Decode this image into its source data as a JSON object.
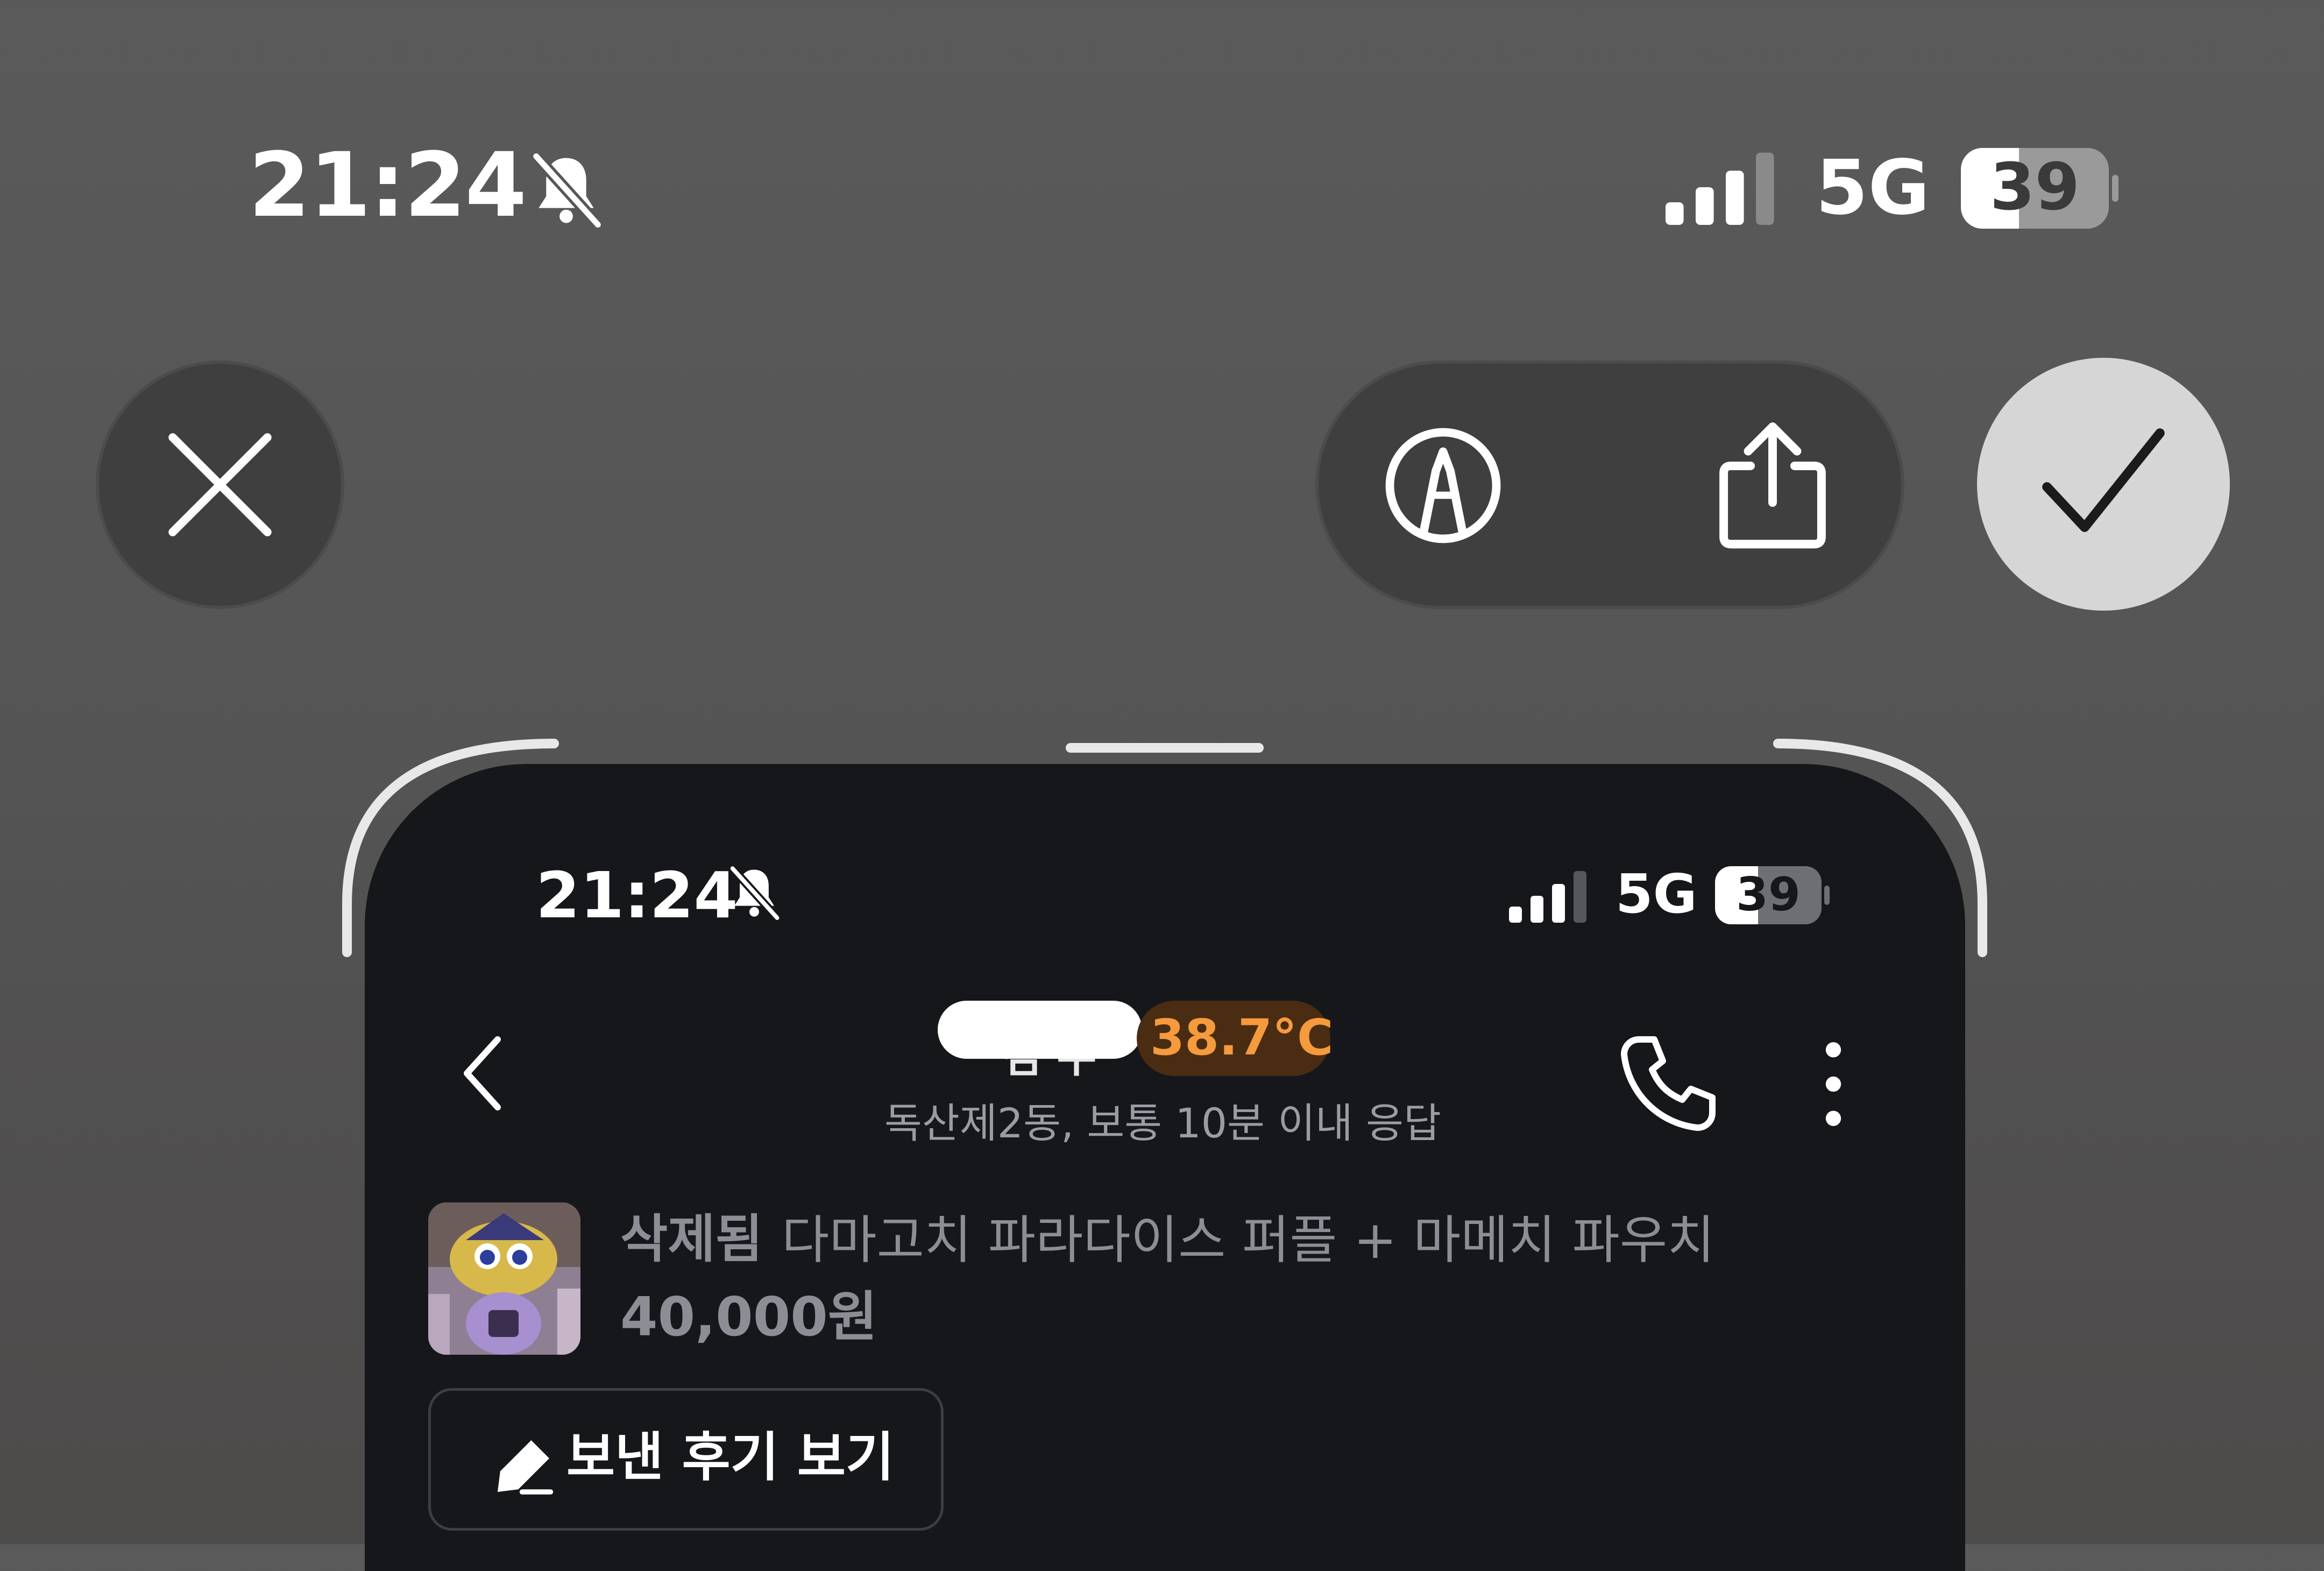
{
  "status_bar": {
    "time": "21:24",
    "network": "5G",
    "battery": "39",
    "battery_level": 0.39,
    "signal_bars_active": 3,
    "signal_bars_total": 4,
    "silent_mode_icon": "bell-slash-icon"
  },
  "editor": {
    "close_icon": "x-icon",
    "markup_icon": "markup-pen-icon",
    "share_icon": "share-icon",
    "done_icon": "checkmark-icon"
  },
  "inner_screen": {
    "status_bar": {
      "time": "21:24",
      "network": "5G",
      "battery": "39"
    },
    "header": {
      "back_icon": "chevron-left-icon",
      "user_name_partial": "김 누",
      "temperature": "38.7°C",
      "location_and_response": "독산제2동, 보통 10분 이내 응답",
      "call_icon": "phone-icon",
      "more_icon": "more-vertical-icon"
    },
    "product": {
      "status": "삭제됨",
      "title": "다마고치 파라다이스 퍼플 + 마메치 파우치",
      "price": "40,000원"
    },
    "review_button": {
      "icon": "pencil-icon",
      "label": "보낸 후기 보기"
    }
  },
  "colors": {
    "temperature_text": "#f59a3d",
    "temperature_bg": "#4a2c12",
    "screen_bg": "#16171b",
    "muted_text": "#8c8e95"
  }
}
